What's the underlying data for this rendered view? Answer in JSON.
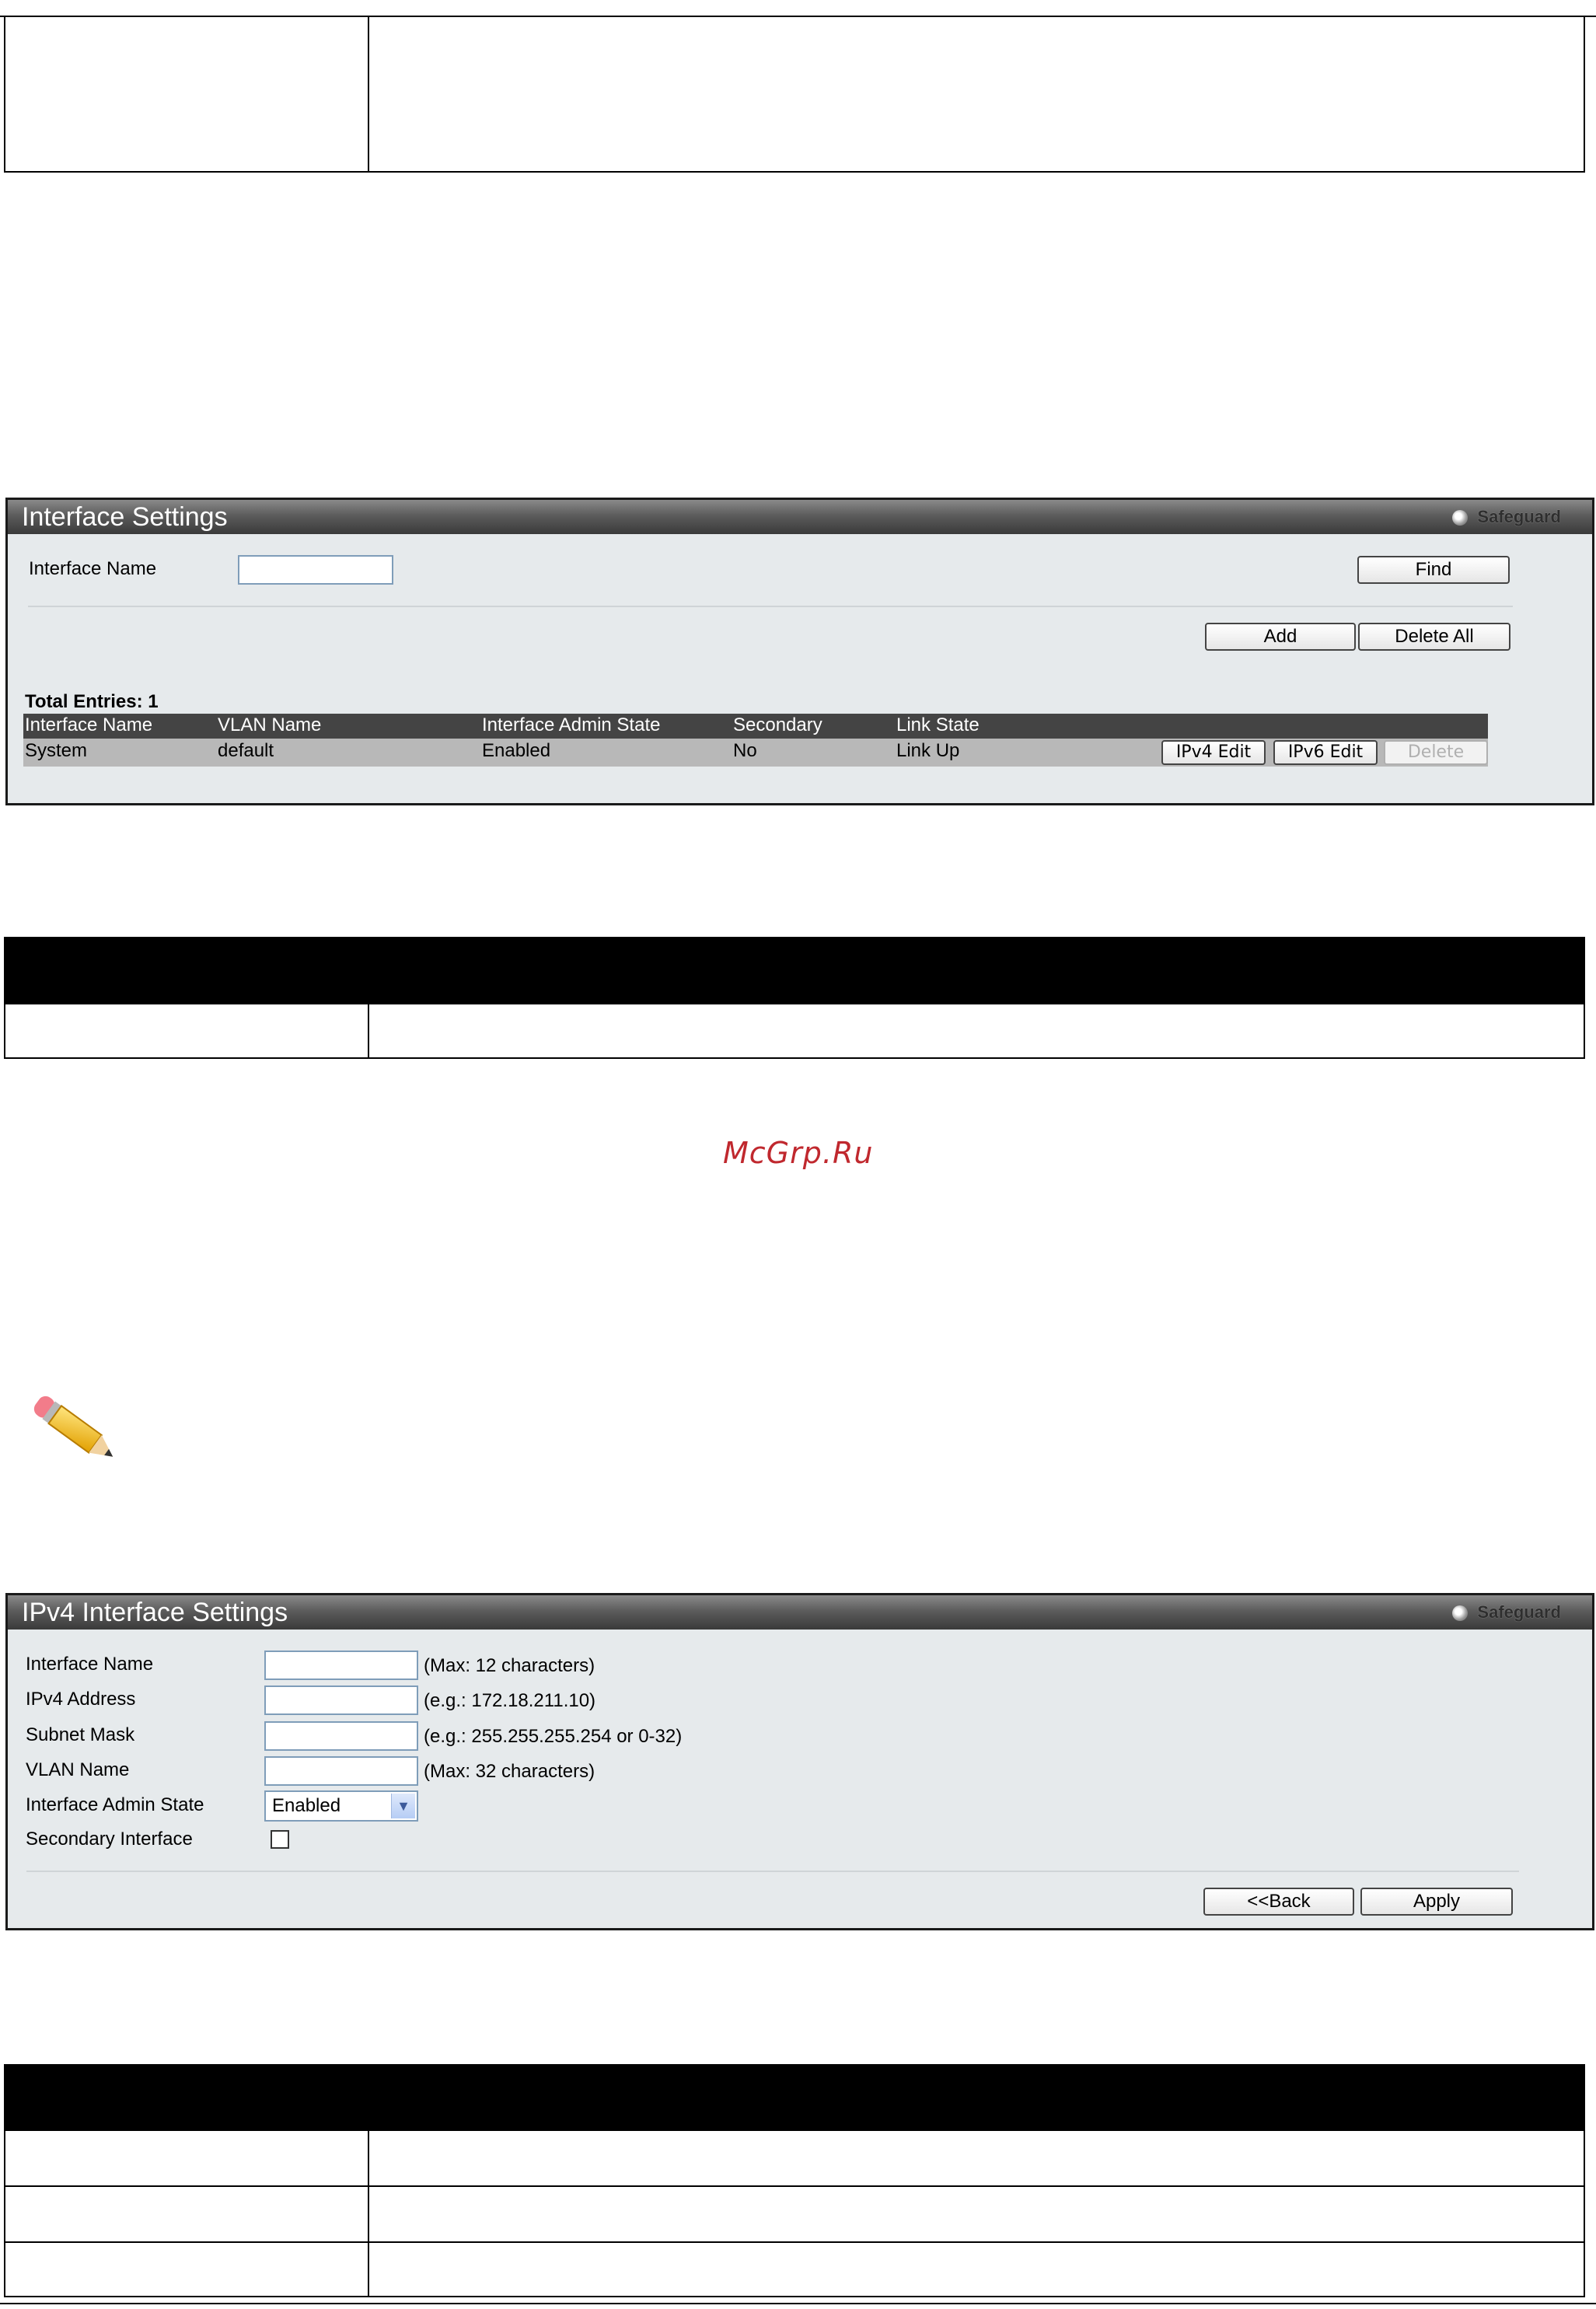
{
  "watermark": "McGrp.Ru",
  "interface_settings": {
    "title": "Interface Settings",
    "safeguard": "Safeguard",
    "interface_name_label": "Interface Name",
    "interface_name_value": "",
    "find_button": "Find",
    "add_button": "Add",
    "delete_all_button": "Delete All",
    "total_entries": "Total Entries: 1",
    "columns": [
      "Interface Name",
      "VLAN Name",
      "Interface Admin State",
      "Secondary",
      "Link State"
    ],
    "rows": [
      {
        "interface_name": "System",
        "vlan_name": "default",
        "admin_state": "Enabled",
        "secondary": "No",
        "link_state": "Link Up",
        "ipv4_edit": "IPv4 Edit",
        "ipv6_edit": "IPv6 Edit",
        "delete": "Delete"
      }
    ]
  },
  "ipv4_settings": {
    "title": "IPv4 Interface Settings",
    "safeguard": "Safeguard",
    "fields": [
      {
        "label": "Interface Name",
        "value": "",
        "hint": "(Max: 12 characters)"
      },
      {
        "label": "IPv4 Address",
        "value": "",
        "hint": "(e.g.: 172.18.211.10)"
      },
      {
        "label": "Subnet Mask",
        "value": "",
        "hint": "(e.g.: 255.255.255.254 or 0-32)"
      },
      {
        "label": "VLAN Name",
        "value": "",
        "hint": "(Max: 32 characters)"
      }
    ],
    "admin_state_label": "Interface Admin State",
    "admin_state_value": "Enabled",
    "secondary_label": "Secondary Interface",
    "secondary_checked": false,
    "back_button": "<<Back",
    "apply_button": "Apply"
  }
}
